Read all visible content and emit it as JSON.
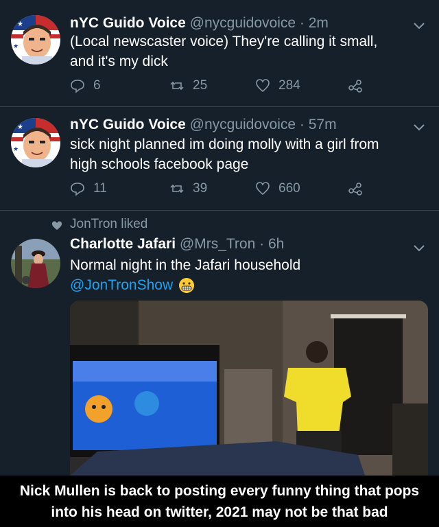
{
  "tweets": [
    {
      "name": "nYC Guido Voice",
      "handle": "@nycguidovoice",
      "time": "· 2m",
      "text_line1": "(Local newscaster voice) They're calling it small,",
      "text_line2": "and it's my dick",
      "replies": "6",
      "retweets": "25",
      "likes": "284"
    },
    {
      "name": "nYC Guido Voice",
      "handle": "@nycguidovoice",
      "time": "· 57m",
      "text_line1": "sick night planned im doing molly with a girl from",
      "text_line2": "high schools facebook page",
      "replies": "11",
      "retweets": "39",
      "likes": "660"
    },
    {
      "liked_by": "JonTron liked",
      "name": "Charlotte Jafari",
      "handle": "@Mrs_Tron",
      "time": "· 6h",
      "text_line1": "Normal night in the Jafari household",
      "mention": "@JonTronShow"
    }
  ],
  "caption": {
    "line1": "Nick Mullen is back to posting every funny thing that pops",
    "line2": "into his head on twitter, 2021 may not be that bad"
  },
  "colors": {
    "background": "#15202b",
    "muted": "#8899a6",
    "link": "#1da1f2",
    "separator": "#38444d"
  },
  "icons": [
    "reply-icon",
    "retweet-icon",
    "like-icon",
    "share-icon",
    "chevron-down-icon",
    "grimace-emoji-icon",
    "heart-filled-icon"
  ]
}
